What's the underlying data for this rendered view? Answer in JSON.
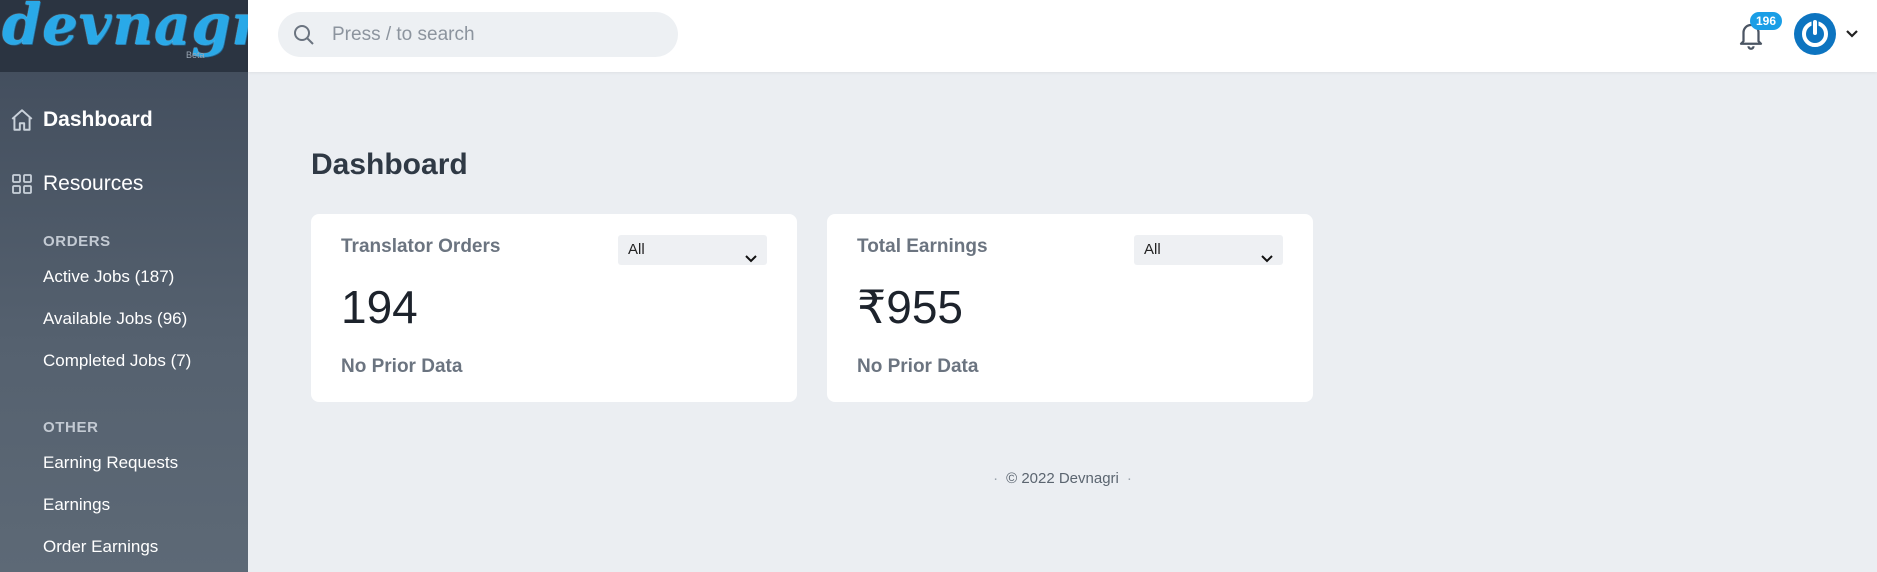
{
  "brand": {
    "logo_text": "devnagri",
    "logo_tag": "Beta"
  },
  "search": {
    "placeholder": "Press / to search"
  },
  "notifications": {
    "count": "196"
  },
  "sidebar": {
    "main_items": [
      {
        "label": "Dashboard",
        "icon": "home-icon",
        "active": true
      },
      {
        "label": "Resources",
        "icon": "grid-icon",
        "active": false
      }
    ],
    "orders_section": "ORDERS",
    "orders_items": [
      "Active Jobs (187)",
      "Available Jobs (96)",
      "Completed Jobs (7)"
    ],
    "other_section": "OTHER",
    "other_items": [
      "Earning Requests",
      "Earnings",
      "Order Earnings"
    ]
  },
  "main": {
    "title": "Dashboard",
    "cards": [
      {
        "title": "Translator Orders",
        "filter": "All",
        "value": "194",
        "sub": "No Prior Data"
      },
      {
        "title": "Total Earnings",
        "filter": "All",
        "value": "₹955",
        "sub": "No Prior Data"
      }
    ]
  },
  "footer": {
    "text": "© 2022 Devnagri"
  },
  "colors": {
    "accent": "#1a9ee6",
    "sidebar": "#4b5665",
    "avatar": "#0d74c0"
  }
}
